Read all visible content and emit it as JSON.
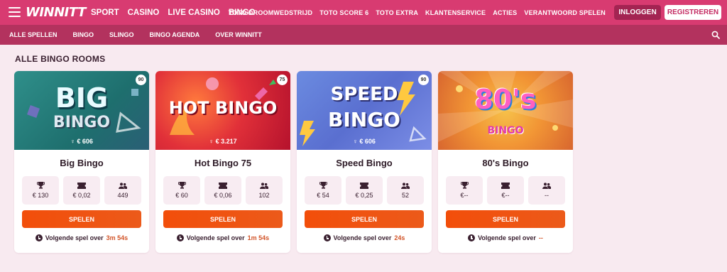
{
  "header": {
    "logo": "WINNITT",
    "main_nav": [
      "SPORT",
      "CASINO",
      "LIVE CASINO",
      "BINGO"
    ],
    "right_nav": [
      "TOTO DROOMWEDSTRIJD",
      "TOTO SCORE 6",
      "TOTO EXTRA",
      "KLANTENSERVICE",
      "ACTIES",
      "VERANTWOORD SPELEN"
    ],
    "login_label": "INLOGGEN",
    "register_label": "REGISTREREN"
  },
  "subnav": {
    "items": [
      "ALLE SPELLEN",
      "BINGO",
      "SLINGO",
      "BINGO AGENDA",
      "OVER WINNITT"
    ]
  },
  "section_title": "ALLE BINGO ROOMS",
  "cards": [
    {
      "art_title_1": "BIG",
      "art_title_2": "BINGO",
      "jackpot": "€ 606",
      "count": "90",
      "name": "Big Bingo",
      "stats": {
        "prize": "€ 130",
        "ticket": "€ 0,02",
        "players": "449"
      },
      "play_label": "SPELEN",
      "next_label": "Volgende spel over",
      "next_time": "3m 54s"
    },
    {
      "art_title_1": "HOT BINGO",
      "art_title_2": "",
      "jackpot": "€ 3.217",
      "count": "75",
      "name": "Hot Bingo 75",
      "stats": {
        "prize": "€ 60",
        "ticket": "€ 0,06",
        "players": "102"
      },
      "play_label": "SPELEN",
      "next_label": "Volgende spel over",
      "next_time": "1m 54s"
    },
    {
      "art_title_1": "SPEED",
      "art_title_2": "BINGO",
      "jackpot": "€ 606",
      "count": "90",
      "name": "Speed Bingo",
      "stats": {
        "prize": "€ 54",
        "ticket": "€ 0,25",
        "players": "52"
      },
      "play_label": "SPELEN",
      "next_label": "Volgende spel over",
      "next_time": "24s"
    },
    {
      "art_title_1": "80's",
      "art_title_2": "BINGO",
      "jackpot": "",
      "count": "",
      "name": "80's Bingo",
      "stats": {
        "prize": "€--",
        "ticket": "€--",
        "players": "--"
      },
      "play_label": "SPELEN",
      "next_label": "Volgende spel over",
      "next_time": "--"
    }
  ],
  "icons": {
    "menu": "hamburger-icon",
    "search": "search-icon",
    "prize": "trophy-icon",
    "ticket": "ticket-icon",
    "players": "players-icon",
    "clock": "clock-icon"
  },
  "colors": {
    "topbar": "#d83b71",
    "subbar": "#b3325e",
    "page_bg": "#f8eaf0",
    "play_button": "#f24e0a",
    "time_accent": "#d2552a"
  }
}
